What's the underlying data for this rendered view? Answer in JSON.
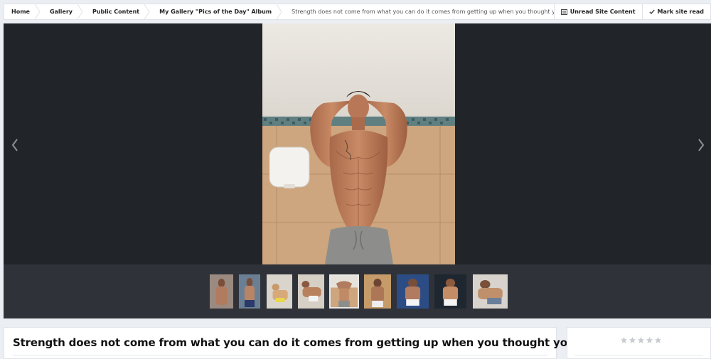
{
  "breadcrumb": {
    "items": [
      {
        "label": "Home"
      },
      {
        "label": "Gallery"
      },
      {
        "label": "Public Content"
      },
      {
        "label": "My Gallery \"Pics of the Day\" Album"
      },
      {
        "label": "Strength does not come from what you can do it comes from getting up when you thought you couldn't"
      }
    ]
  },
  "actions": {
    "unread_label": "Unread Site Content",
    "mark_read_label": "Mark site read"
  },
  "image": {
    "title": "Strength does not come from what you can do it comes from getting up when you thought you couldn’t"
  },
  "thumbnails": {
    "count": 9,
    "active_index": 4
  },
  "rating": {
    "stars_total": 5,
    "stars_filled": 0
  },
  "colors": {
    "viewer_bg": "#212429",
    "strip_bg": "#2f3339",
    "page_bg": "#ebeef2",
    "star_empty": "#c9ccd1"
  }
}
